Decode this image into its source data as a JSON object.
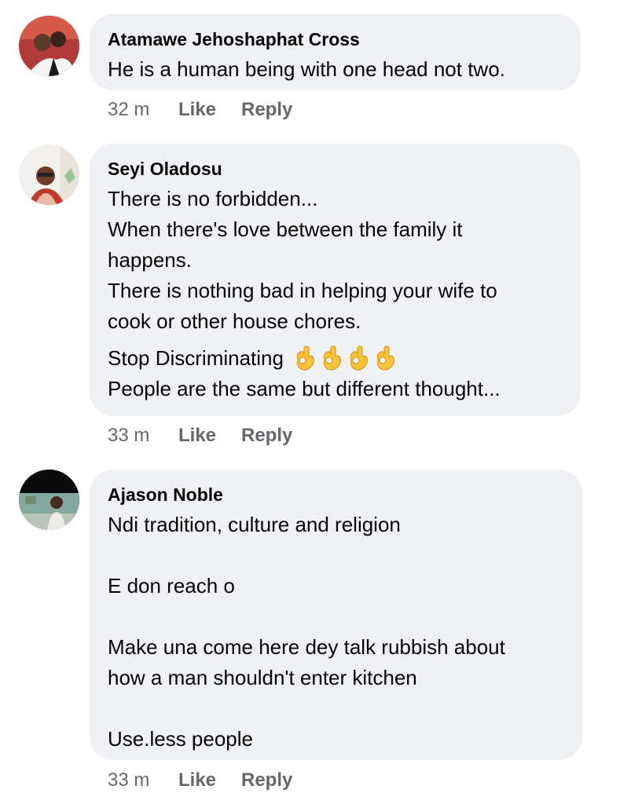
{
  "comments": [
    {
      "author": "Atamawe Jehoshaphat Cross",
      "lines": [
        "He is a human being with one head not two."
      ],
      "time": "32 m",
      "like_label": "Like",
      "reply_label": "Reply"
    },
    {
      "author": "Seyi Oladosu",
      "lines": [
        "There is no forbidden...",
        "When there's love between the family it",
        "happens.",
        "There is nothing bad in helping your wife to",
        "cook or other house chores.",
        "Stop Discriminating",
        "People are the same but different thought..."
      ],
      "emoji": "ok-hand-icon",
      "emoji_count": 4,
      "time": "33 m",
      "like_label": "Like",
      "reply_label": "Reply"
    },
    {
      "author": "Ajason Noble",
      "lines": [
        "Ndi tradition, culture and religion",
        "",
        "E don reach o",
        "",
        "Make una come here dey talk rubbish about",
        "how a man shouldn't enter kitchen",
        "",
        "Use.less people"
      ],
      "time": "33 m",
      "like_label": "Like",
      "reply_label": "Reply"
    }
  ],
  "colors": {
    "bubble": "#eff1f4",
    "meta_text": "#65676b",
    "body_text": "#050505",
    "emoji_yellow": "#f7c33c"
  }
}
